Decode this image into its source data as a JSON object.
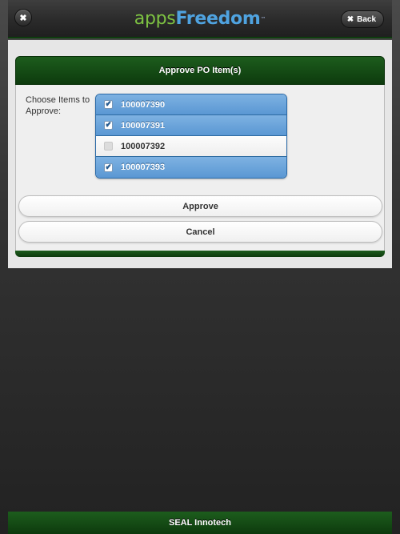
{
  "header": {
    "close_glyph": "✖",
    "logo_part1": "apps",
    "logo_part2": "Freedom",
    "logo_tm": "™",
    "back_glyph": "✖",
    "back_label": "Back"
  },
  "card": {
    "title": "Approve PO Item(s)",
    "choose_label": "Choose Items to Approve:",
    "items": [
      {
        "id": "100007390",
        "checked": true
      },
      {
        "id": "100007391",
        "checked": true
      },
      {
        "id": "100007392",
        "checked": false
      },
      {
        "id": "100007393",
        "checked": true
      }
    ],
    "approve_label": "Approve",
    "cancel_label": "Cancel"
  },
  "footer": {
    "label": "SEAL Innotech"
  },
  "colors": {
    "header_green": "#0d3a0d",
    "selected_blue": "#5a97d3",
    "logo_green": "#7dc242",
    "logo_blue": "#4fa3e0"
  }
}
